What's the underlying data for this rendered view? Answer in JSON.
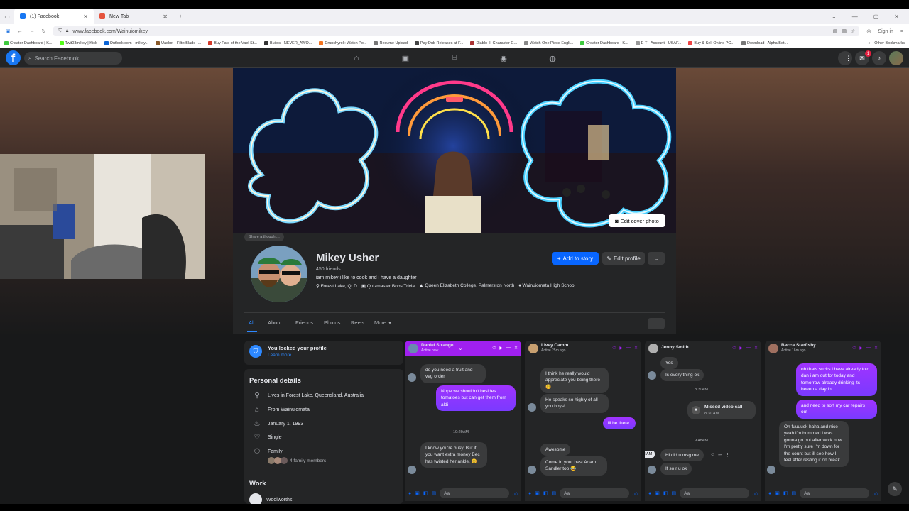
{
  "browser": {
    "tabs": [
      {
        "label": "(1) Facebook",
        "active": true
      },
      {
        "label": "New Tab",
        "active": false
      }
    ],
    "new_tab": "+",
    "url": "www.facebook.com/Wainuiomikey",
    "sign_in": "Sign in",
    "bookmarks": [
      "Creator Dashboard | K...",
      "Twit03mikey | Kick",
      "Outlook.com - mikey...",
      "Uaskot - FilterBlade -...",
      "Buy Fate of the Vael St...",
      "Builds - NEVER_AWO...",
      "Crunchyroll: Watch Po...",
      "Resume Upload",
      "Pay Dub Releases at F...",
      "Diablo III Character G...",
      "Watch One Piece Engli...",
      "Creator Dashboard | K...",
      "E-T - Account - USAF...",
      "Buy & Sell Online PC...",
      "Download | Alpha Bet..."
    ],
    "other_bookmarks": "Other Bookmarks"
  },
  "fb": {
    "logo": "f",
    "search_placeholder": "Search Facebook",
    "notif_count": "1"
  },
  "profile": {
    "share_thought": "Share a thought...",
    "name": "Mikey Usher",
    "friends": "450 friends",
    "bio": "iam mikey i like to cook and i have a daughter",
    "facts": [
      "Forest Lake, QLD",
      "Quizmaster Bobs Trivia",
      "Queen Elizabeth College, Palmerston North",
      "Wainuiomata High School"
    ],
    "add_story": "Add to story",
    "edit_profile": "Edit profile",
    "edit_cover": "Edit cover photo",
    "tabs": [
      "All",
      "About",
      "Friends",
      "Photos",
      "Reels",
      "More"
    ],
    "more_dots": "···"
  },
  "locked": {
    "title": "You locked your profile",
    "link": "Learn more"
  },
  "details": {
    "heading": "Personal details",
    "items": [
      "Lives in Forest Lake, Queensland, Australia",
      "From Wainuiomata",
      "January 1, 1993",
      "Single",
      "Family"
    ],
    "family_members": "4 family members",
    "work_heading": "Work",
    "work_item": "Woolworths"
  },
  "chats": [
    {
      "name": "Daniel Strange",
      "status": "Active now",
      "messages": [
        {
          "dir": "in",
          "text": "do you need a fruit and veg order"
        },
        {
          "dir": "out",
          "text": "Nope we shouldn't besides tomatoes but can get them from aldi"
        },
        {
          "dir": "time",
          "text": "10:29AM"
        },
        {
          "dir": "in",
          "text": "I know you're busy. But if you want extra money Bec has twisted her ankle. 😊"
        }
      ]
    },
    {
      "name": "Livvy Camm",
      "status": "Active 25m ago",
      "messages": [
        {
          "dir": "in",
          "text": "I think he really would appreciate you being there 😊"
        },
        {
          "dir": "in",
          "text": "He speaks so highly of all you boys!"
        },
        {
          "dir": "out",
          "text": "ill be there"
        },
        {
          "dir": "in",
          "text": "Awesome"
        },
        {
          "dir": "in",
          "text": "Come in your best Adam Sandler too 😂"
        }
      ]
    },
    {
      "name": "Jenny Smith",
      "status": "",
      "messages": [
        {
          "dir": "in",
          "text": "Yes"
        },
        {
          "dir": "in",
          "text": "Is every thing ok"
        },
        {
          "dir": "time",
          "text": "8:30AM"
        },
        {
          "dir": "in",
          "text": "Missed video call"
        },
        {
          "dir": "sub",
          "text": "8:30 AM"
        },
        {
          "dir": "time",
          "text": "9:48AM"
        },
        {
          "dir": "tip",
          "text": "9:48 AM"
        },
        {
          "dir": "in",
          "text": "Hi.did u msg me"
        },
        {
          "dir": "in",
          "text": "If so r u ok"
        }
      ]
    },
    {
      "name": "Becca Starfishy",
      "status": "Active 16m ago",
      "messages": [
        {
          "dir": "out",
          "text": "oh thats sucks i have already told dan i am out for today and tomorrow already drinking its beeen a day lol"
        },
        {
          "dir": "out",
          "text": "and need to sort my car repairs out"
        },
        {
          "dir": "in",
          "text": "Oh fuuuuck haha and nice yeah I'm bummed I was gonna go out after work now I'm pretty sure I'm down for the count but ill see how I feel after resting it on break"
        }
      ]
    }
  ],
  "composer_placeholder": "Aa"
}
